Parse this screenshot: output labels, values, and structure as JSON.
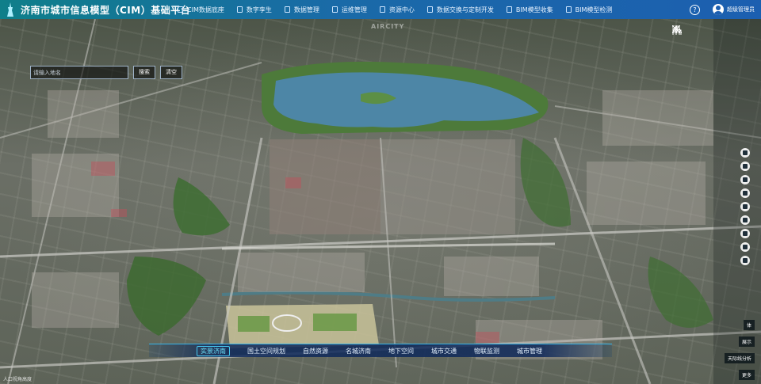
{
  "header": {
    "title": "济南市城市信息模型（CIM）基础平台",
    "nav": [
      {
        "label": "CIM数据底座"
      },
      {
        "label": "数字孪生"
      },
      {
        "label": "数据管理"
      },
      {
        "label": "运维管理"
      },
      {
        "label": "资源中心"
      },
      {
        "label": "数据交换与定制开发"
      },
      {
        "label": "BIM模型收集"
      },
      {
        "label": "BIM模型检测"
      }
    ],
    "help_glyph": "?",
    "user": "超级管理员",
    "colors": {
      "gradient_start": "#0f7f8a",
      "gradient_end": "#1c5fb0"
    }
  },
  "search": {
    "placeholder": "请输入地名",
    "search_label": "搜索",
    "clear_label": "清空"
  },
  "map": {
    "watermark": "AIRCITY",
    "coords": "人口视角高度",
    "tools": [
      "compass-icon",
      "terrain-icon",
      "buildings-icon",
      "fullscreen-icon"
    ],
    "side_icons": [
      "layers-icon",
      "hand-icon",
      "video-icon",
      "measure-icon",
      "monitor-icon",
      "close-tool-icon",
      "grid-icon",
      "settings-icon",
      "help-icon"
    ],
    "side_labels": [
      "体",
      "展示",
      "天际线分析",
      "更多"
    ]
  },
  "bottombar": {
    "items": [
      {
        "label": "实景济南",
        "active": true
      },
      {
        "label": "国土空间规划",
        "active": false
      },
      {
        "label": "自然资源",
        "active": false
      },
      {
        "label": "名城济南",
        "active": false
      },
      {
        "label": "地下空间",
        "active": false
      },
      {
        "label": "城市交通",
        "active": false
      },
      {
        "label": "物联监测",
        "active": false
      },
      {
        "label": "城市管理",
        "active": false
      }
    ]
  }
}
